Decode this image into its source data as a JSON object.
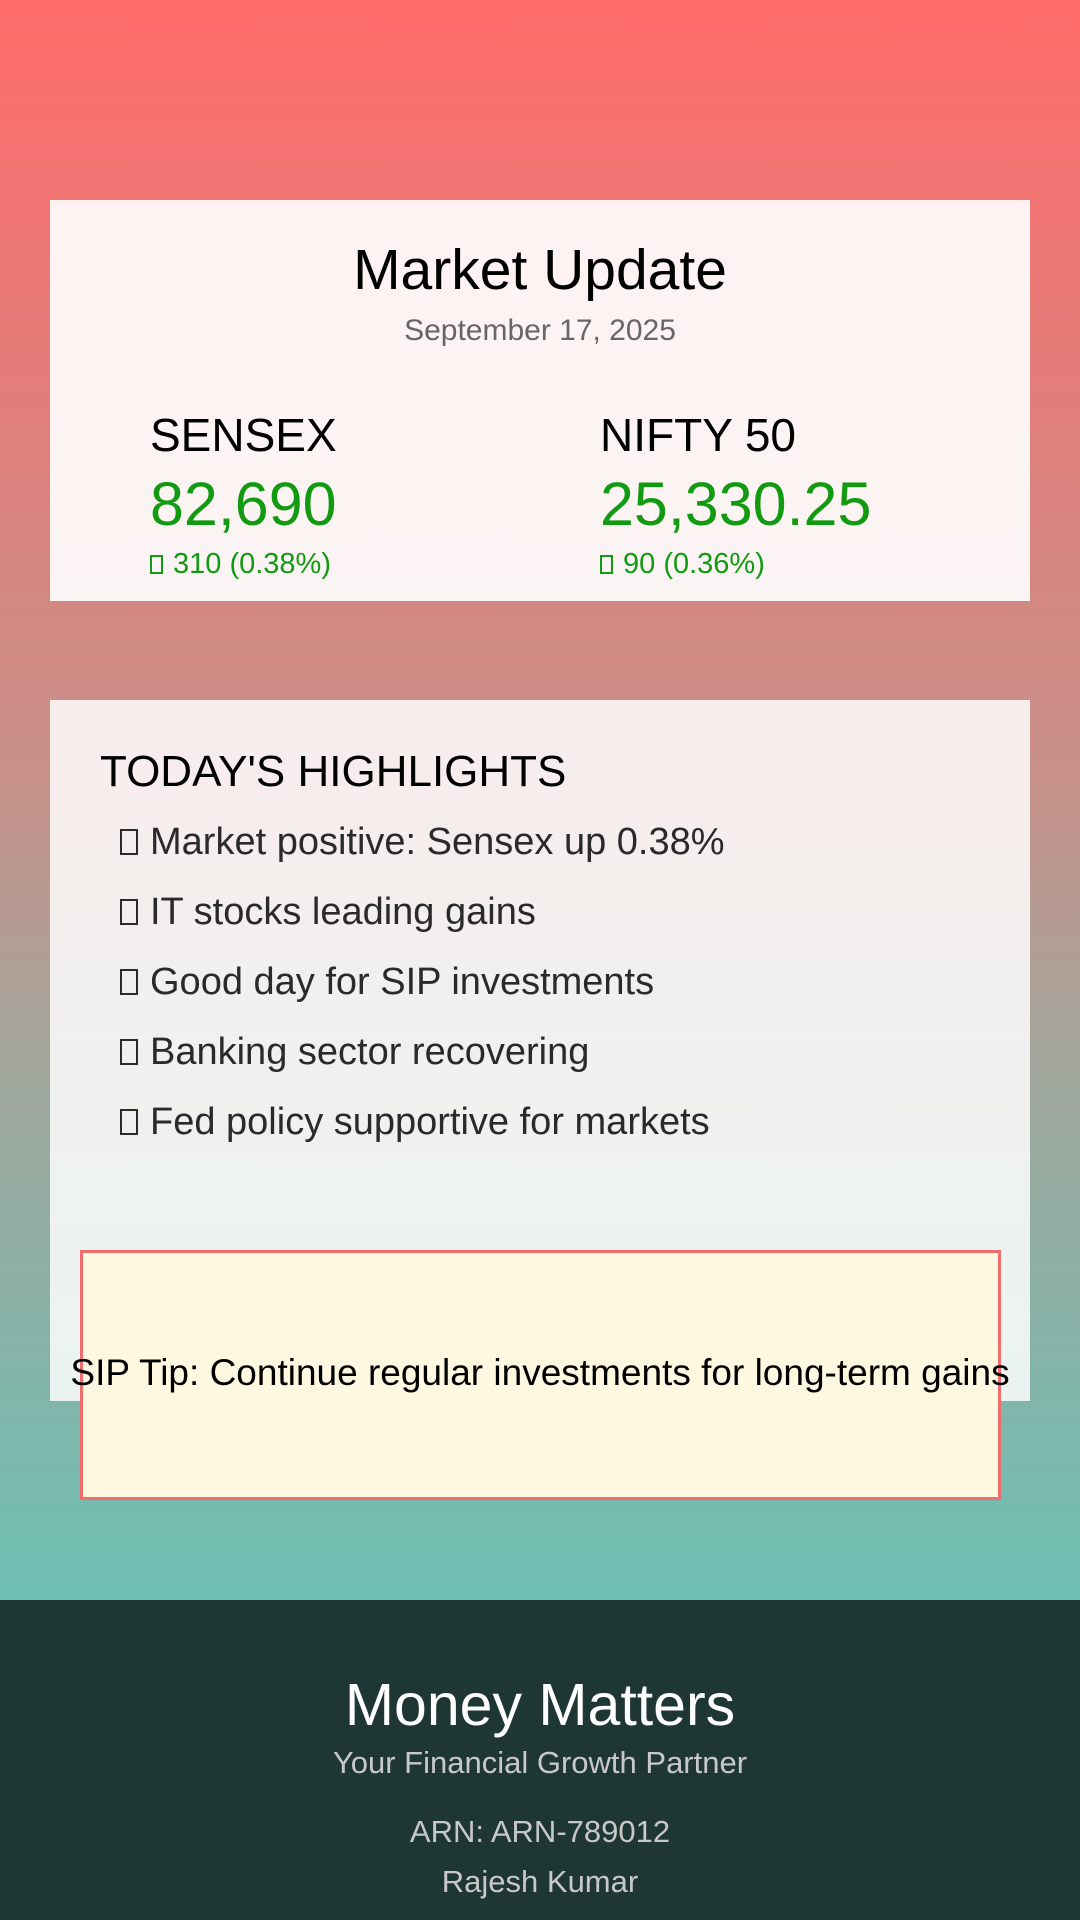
{
  "market": {
    "title": "Market Update",
    "date": "September 17, 2025",
    "indices": [
      {
        "name": "SENSEX",
        "value": "82,690",
        "change": "310 (0.38%)",
        "direction": "up"
      },
      {
        "name": "NIFTY 50",
        "value": "25,330.25",
        "change": "90 (0.36%)",
        "direction": "up"
      }
    ]
  },
  "highlights": {
    "title": "TODAY'S HIGHLIGHTS",
    "items": [
      "Market positive: Sensex up 0.38%",
      "IT stocks leading gains",
      "Good day for SIP investments",
      "Banking sector recovering",
      "Fed policy supportive for markets"
    ]
  },
  "sip_tip": "SIP Tip: Continue regular investments for long-term gains",
  "footer": {
    "brand": "Money Matters",
    "tagline": "Your Financial Growth Partner",
    "arn": "ARN: ARN-789012",
    "name": "Rajesh Kumar"
  },
  "colors": {
    "positive": "#129a12",
    "footer_bg": "#1e3735",
    "tip_bg": "#fef8e1",
    "tip_border": "#ef6d6d",
    "gradient_top": "#ff6b6b",
    "gradient_bottom": "#6cbfb3"
  }
}
